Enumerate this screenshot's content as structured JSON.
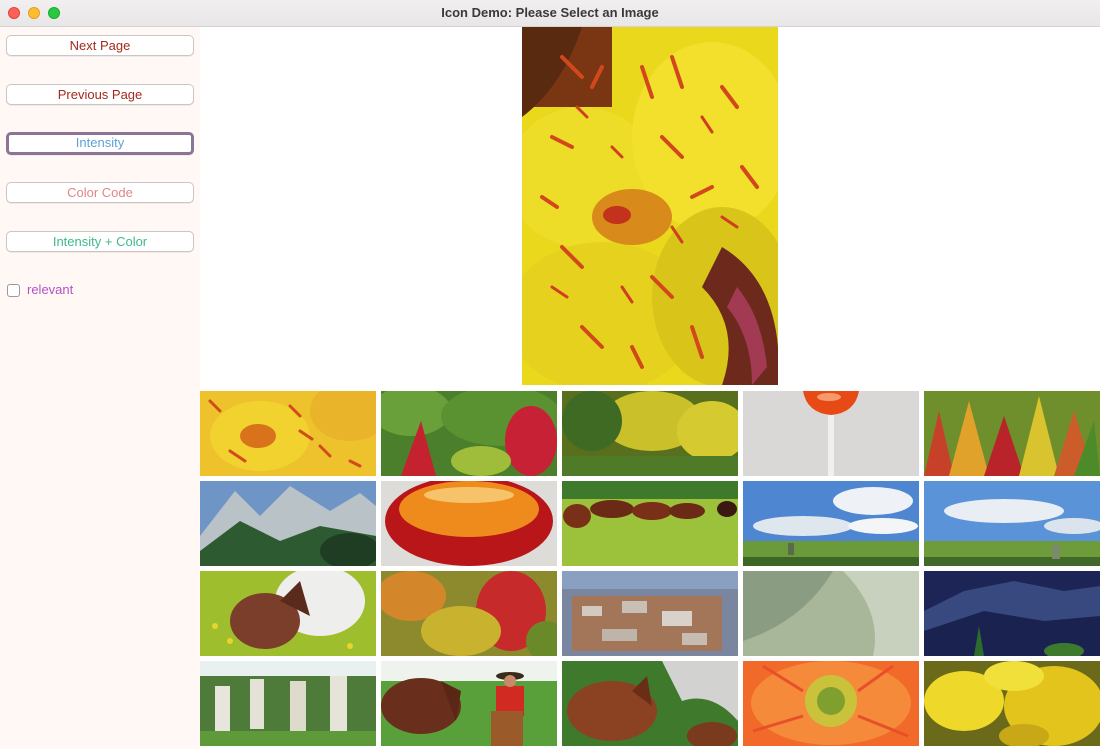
{
  "window": {
    "title": "Icon Demo: Please Select an Image"
  },
  "buttons": {
    "next": {
      "label": "Next Page",
      "color": "#a2291d"
    },
    "previous": {
      "label": "Previous Page",
      "color": "#a2291d"
    },
    "intensity": {
      "label": "Intensity",
      "color": "#5fa3d1"
    },
    "color_code": {
      "label": "Color Code",
      "color": "#e28585"
    },
    "intensity_color": {
      "label": "Intensity + Color",
      "color": "#3fb98a"
    }
  },
  "relevant_checkbox": {
    "label": "relevant",
    "checked": false,
    "color": "#b152c9"
  },
  "preview": {
    "subject": "yellow-flower-red-speckles"
  },
  "thumbnails": [
    {
      "subject": "yellow-flower-closeup"
    },
    {
      "subject": "red-green-shrubs"
    },
    {
      "subject": "autumn-forest-yellow"
    },
    {
      "subject": "glass-of-orange-drink"
    },
    {
      "subject": "colorful-autumn-trees"
    },
    {
      "subject": "snowy-mountains-and-trees"
    },
    {
      "subject": "glass-of-amber-liquid"
    },
    {
      "subject": "horses-running-in-field"
    },
    {
      "subject": "prairie-with-clouds"
    },
    {
      "subject": "prairie-with-clouds-rider"
    },
    {
      "subject": "brown-foal-and-white-horse"
    },
    {
      "subject": "autumn-foliage-branches"
    },
    {
      "subject": "city-aerial-view"
    },
    {
      "subject": "pale-green-leaf-closeup"
    },
    {
      "subject": "blue-hills-and-pine"
    },
    {
      "subject": "white-grave-stones"
    },
    {
      "subject": "cowboy-with-horse"
    },
    {
      "subject": "horse-by-rock"
    },
    {
      "subject": "orange-gerbera-daisy"
    },
    {
      "subject": "yellow-flowers-closeup"
    }
  ]
}
